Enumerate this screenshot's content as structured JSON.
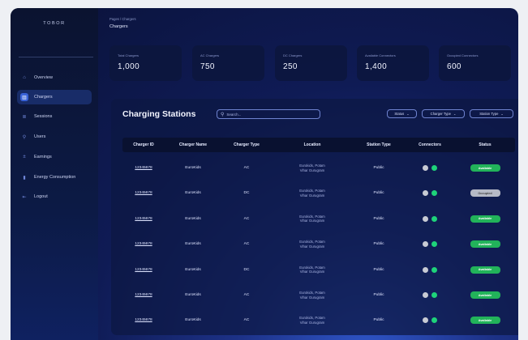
{
  "app": {
    "logo": "TOBOR"
  },
  "header": {
    "breadcrumb": "Pages / Chargers",
    "title": "Chargers"
  },
  "sidebar": {
    "items": [
      {
        "label": "Overview",
        "icon": "home-icon",
        "glyph": "⌂"
      },
      {
        "label": "Chargers",
        "icon": "chargers-icon",
        "glyph": "▥"
      },
      {
        "label": "Sessions",
        "icon": "sessions-icon",
        "glyph": "≣"
      },
      {
        "label": "Users",
        "icon": "users-icon",
        "glyph": "⚲"
      },
      {
        "label": "Earnings",
        "icon": "earnings-icon",
        "glyph": "±"
      },
      {
        "label": "Energy Consumption",
        "icon": "energy-icon",
        "glyph": "▮"
      },
      {
        "label": "Logout",
        "icon": "logout-icon",
        "glyph": "⇤"
      }
    ]
  },
  "stats": [
    {
      "label": "Total Chargers",
      "value": "1,000"
    },
    {
      "label": "AC Chargers",
      "value": "750"
    },
    {
      "label": "DC Chargers",
      "value": "250"
    },
    {
      "label": "Available Connectors",
      "value": "1,400"
    },
    {
      "label": "Occupied Connectors",
      "value": "600"
    }
  ],
  "panel": {
    "title": "Charging Stations",
    "search_placeholder": "Search...",
    "filters": [
      {
        "label": "Status"
      },
      {
        "label": "Charger Type"
      },
      {
        "label": "Station Type"
      }
    ],
    "columns": [
      "Charger ID",
      "Charger Name",
      "Charger Type",
      "Location",
      "Station Type",
      "Connectors",
      "Status"
    ],
    "rows": [
      {
        "id": "12345678",
        "name": "EuroKids",
        "type": "AC",
        "loc1": "Eurokids, Potam",
        "loc2": "Vihar Gurugram",
        "station": "Public",
        "status": "Available"
      },
      {
        "id": "12345678",
        "name": "EuroKids",
        "type": "DC",
        "loc1": "Eurokids, Potam",
        "loc2": "Vihar Gurugram",
        "station": "Public",
        "status": "Occupied"
      },
      {
        "id": "12345678",
        "name": "EuroKids",
        "type": "AC",
        "loc1": "Eurokids, Potam",
        "loc2": "Vihar Gurugram",
        "station": "Public",
        "status": "Available"
      },
      {
        "id": "12345678",
        "name": "EuroKids",
        "type": "AC",
        "loc1": "Eurokids, Potam",
        "loc2": "Vihar Gurugram",
        "station": "Public",
        "status": "Available"
      },
      {
        "id": "12345678",
        "name": "EuroKids",
        "type": "DC",
        "loc1": "Eurokids, Potam",
        "loc2": "Vihar Gurugram",
        "station": "Public",
        "status": "Available"
      },
      {
        "id": "12345678",
        "name": "EuroKids",
        "type": "AC",
        "loc1": "Eurokids, Potam",
        "loc2": "Vihar Gurugram",
        "station": "Public",
        "status": "Available"
      },
      {
        "id": "12345678",
        "name": "EuroKids",
        "type": "AC",
        "loc1": "Eurokids, Potam",
        "loc2": "Vihar Gurugram",
        "station": "Public",
        "status": "Available"
      }
    ]
  },
  "colors": {
    "accent": "#3a63d8",
    "available": "#22b35a",
    "occupied": "#b6bac6",
    "connector_on": "#1ed37a",
    "connector_off": "#c8cbd4"
  }
}
